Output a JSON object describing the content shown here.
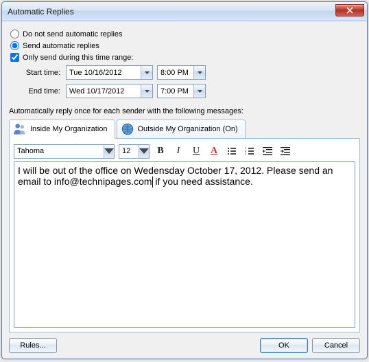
{
  "window": {
    "title": "Automatic Replies"
  },
  "options": {
    "do_not_send": "Do not send automatic replies",
    "send_auto": "Send automatic replies",
    "only_range": "Only send during this time range:",
    "start_label": "Start time:",
    "end_label": "End time:",
    "start_date": "Tue 10/16/2012",
    "start_time": "8:00 PM",
    "end_date": "Wed 10/17/2012",
    "end_time": "7:00 PM"
  },
  "section_label": "Automatically reply once for each sender with the following messages:",
  "tabs": {
    "inside": "Inside My Organization",
    "outside": "Outside My Organization (On)"
  },
  "format": {
    "font": "Tahoma",
    "size": "12",
    "bold": "B",
    "italic": "I",
    "underline": "U",
    "fontcolor": "A"
  },
  "message": {
    "part1": "I will be out of the office on Wedensday October 17, 2012. Please send an email to info@technipages.com",
    "part2": " if you need assistance."
  },
  "buttons": {
    "rules": "Rules...",
    "ok": "OK",
    "cancel": "Cancel"
  }
}
